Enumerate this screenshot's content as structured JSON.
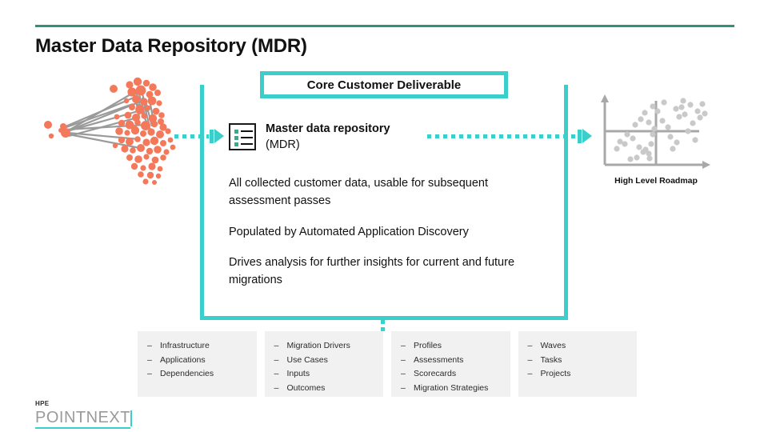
{
  "slide": {
    "title": "Master Data Repository (MDR)",
    "accent_green": "#2E9178",
    "accent_teal": "#3BCFCB",
    "node_color": "#F4795B"
  },
  "badge": {
    "label": "Core Customer Deliverable"
  },
  "mdr": {
    "icon_name": "list-document-icon",
    "heading": "Master data repository",
    "subheading": "(MDR)",
    "paragraphs": [
      "All collected customer data, usable for subsequent assessment passes",
      "Populated by Automated Application Discovery",
      "Drives analysis for further insights for current and future migrations"
    ]
  },
  "arrows": {
    "left_name": "dotted-arrow-into-mdr",
    "right_name": "dotted-arrow-to-roadmap"
  },
  "network_graph": {
    "name": "application-dependency-network-graph",
    "node_color": "#F4795B",
    "edge_color": "#9a9a9a"
  },
  "roadmap": {
    "label": "High Level Roadmap",
    "name": "high-level-roadmap-scatter",
    "point_color": "#c9c9c9",
    "axis_color": "#a8a8a8"
  },
  "categories": [
    {
      "name": "infrastructure-group",
      "items": [
        "Infrastructure",
        "Applications",
        "Dependencies"
      ]
    },
    {
      "name": "migration-drivers-group",
      "items": [
        "Migration Drivers",
        "Use Cases",
        "Inputs",
        "Outcomes"
      ]
    },
    {
      "name": "profiles-group",
      "items": [
        "Profiles",
        "Assessments",
        "Scorecards",
        "Migration Strategies"
      ]
    },
    {
      "name": "waves-group",
      "items": [
        "Waves",
        "Tasks",
        "Projects"
      ]
    }
  ],
  "bullet_dash": "–",
  "logo": {
    "brand": "HPE",
    "wordmark": "POINTNEXT"
  },
  "chart_data": {
    "type": "scatter",
    "title": "High Level Roadmap",
    "xlabel": "",
    "ylabel": "",
    "grid": false,
    "legend": "none",
    "xlim": [
      0,
      100
    ],
    "ylim": [
      0,
      100
    ],
    "quadrant_lines": {
      "x": 50,
      "y": 50
    },
    "series": [
      {
        "name": "applications",
        "color": "#c9c9c9",
        "points": [
          [
            14,
            22
          ],
          [
            22,
            30
          ],
          [
            28,
            38
          ],
          [
            26,
            12
          ],
          [
            32,
            14
          ],
          [
            34,
            26
          ],
          [
            38,
            20
          ],
          [
            44,
            18
          ],
          [
            46,
            30
          ],
          [
            48,
            44
          ],
          [
            30,
            55
          ],
          [
            36,
            62
          ],
          [
            40,
            70
          ],
          [
            44,
            58
          ],
          [
            48,
            78
          ],
          [
            52,
            72
          ],
          [
            56,
            60
          ],
          [
            58,
            88
          ],
          [
            62,
            52
          ],
          [
            64,
            40
          ],
          [
            66,
            26
          ],
          [
            70,
            34
          ],
          [
            72,
            64
          ],
          [
            74,
            80
          ],
          [
            76,
            70
          ],
          [
            80,
            48
          ],
          [
            82,
            84
          ],
          [
            84,
            58
          ],
          [
            86,
            36
          ],
          [
            88,
            74
          ],
          [
            90,
            66
          ],
          [
            92,
            82
          ],
          [
            18,
            34
          ],
          [
            24,
            44
          ],
          [
            54,
            24
          ],
          [
            60,
            16
          ],
          [
            68,
            78
          ],
          [
            78,
            90
          ],
          [
            94,
            72
          ],
          [
            50,
            36
          ]
        ]
      }
    ]
  }
}
